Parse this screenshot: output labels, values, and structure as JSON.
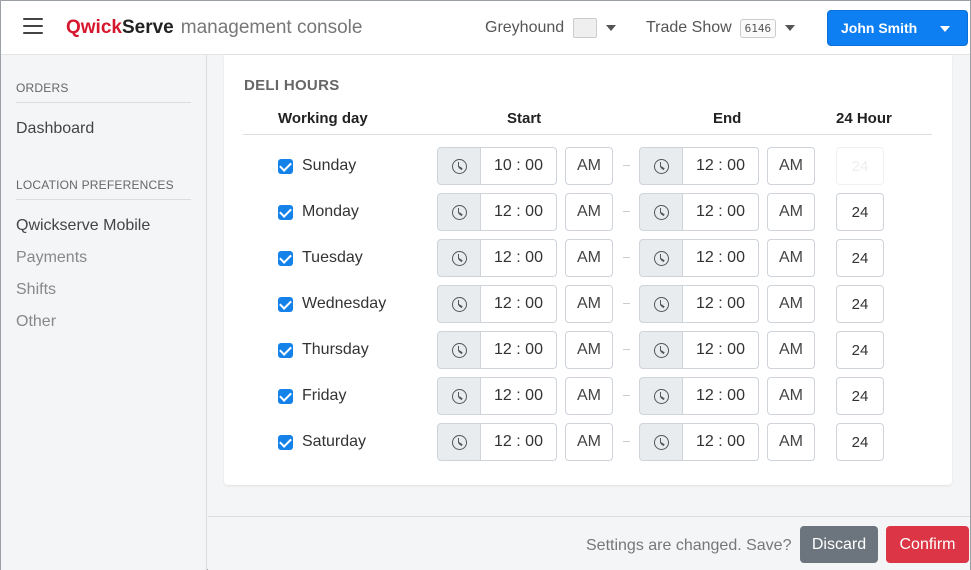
{
  "header": {
    "brand_part1": "Qwick",
    "brand_part2": "Serve",
    "brand_sub": "management console",
    "location": "Greyhound",
    "event": "Trade Show",
    "event_code": "6146",
    "user": "John Smith"
  },
  "sidebar": {
    "section1": "ORDERS",
    "item_dashboard": "Dashboard",
    "section2": "LOCATION PREFERENCES",
    "item_mobile": "Qwickserve Mobile",
    "item_payments": "Payments",
    "item_shifts": "Shifts",
    "item_other": "Other"
  },
  "main": {
    "title": "DELI HOURS",
    "col_day": "Working day",
    "col_start": "Start",
    "col_end": "End",
    "col_24": "24 Hour",
    "rows": [
      {
        "day": "Sunday",
        "start": "10 : 00",
        "start_ampm": "AM",
        "end": "12 : 00",
        "end_ampm": "AM",
        "hours": "24"
      },
      {
        "day": "Monday",
        "start": "12 : 00",
        "start_ampm": "AM",
        "end": "12 : 00",
        "end_ampm": "AM",
        "hours": "24"
      },
      {
        "day": "Tuesday",
        "start": "12 : 00",
        "start_ampm": "AM",
        "end": "12 : 00",
        "end_ampm": "AM",
        "hours": "24"
      },
      {
        "day": "Wednesday",
        "start": "12 : 00",
        "start_ampm": "AM",
        "end": "12 : 00",
        "end_ampm": "AM",
        "hours": "24"
      },
      {
        "day": "Thursday",
        "start": "12 : 00",
        "start_ampm": "AM",
        "end": "12 : 00",
        "end_ampm": "AM",
        "hours": "24"
      },
      {
        "day": "Friday",
        "start": "12 : 00",
        "start_ampm": "AM",
        "end": "12 : 00",
        "end_ampm": "AM",
        "hours": "24"
      },
      {
        "day": "Saturday",
        "start": "12 : 00",
        "start_ampm": "AM",
        "end": "12 : 00",
        "end_ampm": "AM",
        "hours": "24"
      }
    ]
  },
  "footer": {
    "message": "Settings are changed. Save?",
    "discard": "Discard",
    "confirm": "Confirm"
  },
  "colors": {
    "brand_red": "#d7172e",
    "primary": "#0d7ff2",
    "danger": "#dc3545",
    "secondary": "#6c757d"
  }
}
